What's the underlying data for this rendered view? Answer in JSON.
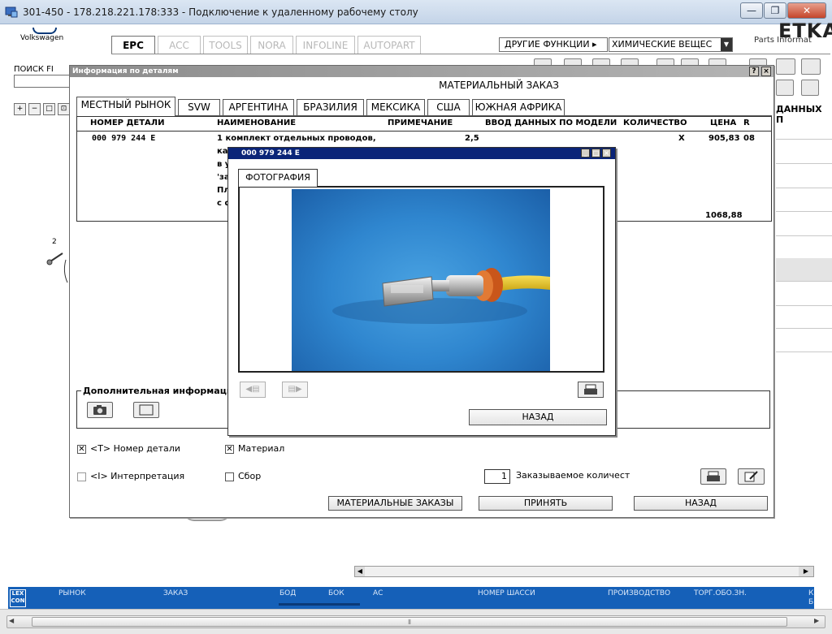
{
  "window": {
    "title": "301-450 - 178.218.221.178:333 - Подключение к удаленному рабочему столу",
    "min": "—",
    "max": "❐",
    "close": "✕"
  },
  "app": {
    "brand": "Volkswagen",
    "logo_text": "ETKA",
    "logo_sub": "Parts Informat",
    "tabs": [
      "EPC",
      "ACC",
      "TOOLS",
      "NORA",
      "INFOLINE",
      "AUTOPART"
    ],
    "other_functions": "ДРУГИЕ ФУНКЦИИ ▸",
    "chem_select": "ХИМИЧЕСКИЕ ВЕЩЕС",
    "search_label": "ПОИСК FI",
    "right_header": "ДАННЫХ П",
    "diagram_num": "2"
  },
  "dialog": {
    "title": "Информация по деталям",
    "heading": "МАТЕРИАЛЬНЫЙ ЗАКАЗ",
    "help": "?",
    "close": "×",
    "tabs": [
      "МЕСТНЫЙ РЫНОК",
      "SVW",
      "АРГЕНТИНА",
      "БРАЗИЛИЯ",
      "МЕКСИКА",
      "США",
      "ЮЖНАЯ АФРИКА"
    ],
    "columns": [
      "НОМЕР ДЕТАЛИ",
      "НАИМЕНОВАНИЕ",
      "ПРИМЕЧАНИЕ",
      "ВВОД ДАННЫХ ПО МОДЕЛИ",
      "КОЛИЧЕСТВО",
      "ЦЕНА",
      "R"
    ],
    "row": {
      "part_no": "000  979  244  E",
      "name_lines": [
        "1 комплект отдельных проводов,",
        "ка",
        "в у",
        "'за",
        "Пл",
        "с ф"
      ],
      "note": "2,5",
      "qty": "X",
      "price": "905,83",
      "r": "08"
    },
    "total": "1068,88",
    "additional_info": "Дополнительная информация",
    "checks": [
      {
        "label": "<T> Номер детали",
        "checked": true
      },
      {
        "label": "Материал",
        "checked": true
      },
      {
        "label": "<I> Интерпретация",
        "checked": false
      },
      {
        "label": "Сбор",
        "checked": false
      }
    ],
    "order_qty_value": "1",
    "order_qty_label": "Заказываемое количест",
    "btn_orders": "МАТЕРИАЛЬНЫЕ ЗАКАЗЫ",
    "btn_accept": "ПРИНЯТЬ",
    "btn_back": "НАЗАД"
  },
  "photo_dialog": {
    "title": "000 979 244 E",
    "tab": "ФОТОГРАФИЯ",
    "back": "НАЗАД"
  },
  "statusbar": {
    "badge": "LEX CON",
    "items": [
      "РЫНОК",
      "ЗАКАЗ",
      "БОД",
      "БОК",
      "АС",
      "НОМЕР ШАССИ",
      "ПРОИЗВОДСТВО",
      "ТОРГ.ОБО.ЗН."
    ],
    "right": "К Б"
  },
  "colors": {
    "statusbar": "#1560b8",
    "photo_titlebar": "#0a2478",
    "photo_background": "#2f86cf",
    "wire": "#e8c422",
    "seal": "#d9661f"
  }
}
